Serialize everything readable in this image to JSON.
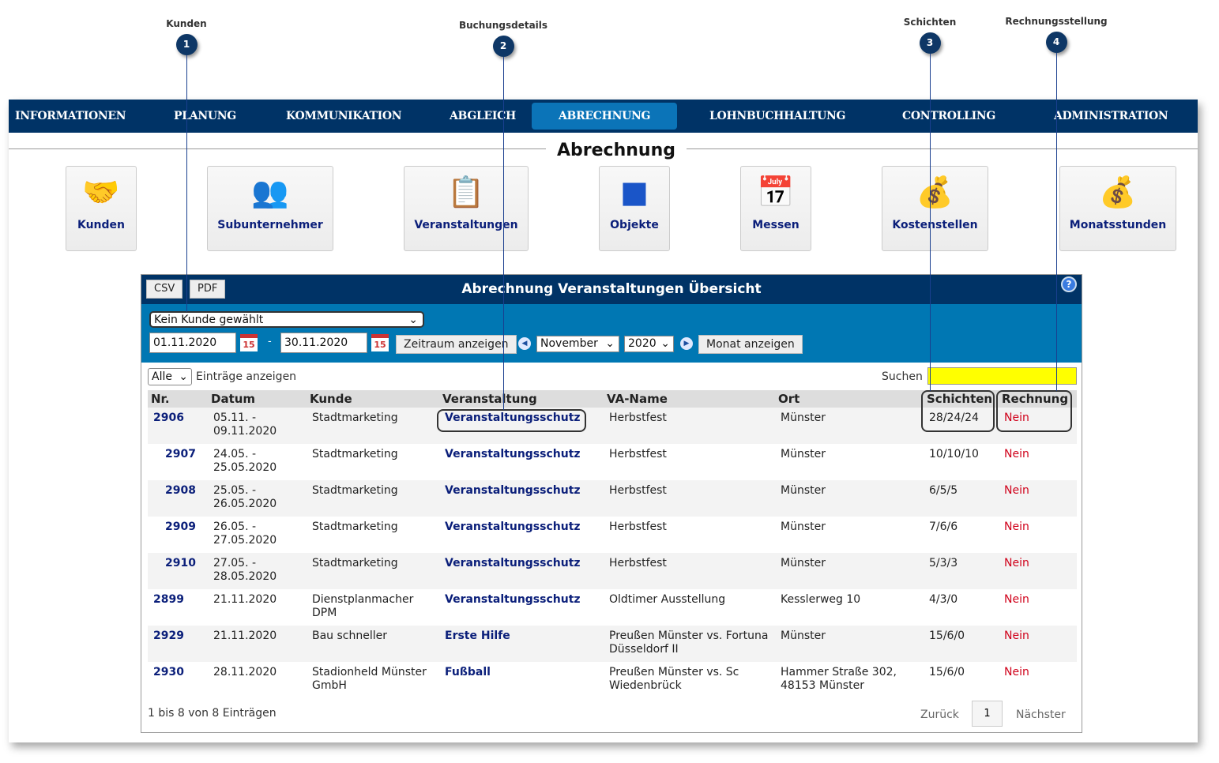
{
  "callouts": [
    {
      "n": "1",
      "label": "Kunden"
    },
    {
      "n": "2",
      "label": "Buchungsdetails"
    },
    {
      "n": "3",
      "label": "Schichten"
    },
    {
      "n": "4",
      "label": "Rechnungsstellung"
    }
  ],
  "nav": [
    "INFORMATIONEN",
    "PLANUNG",
    "KOMMUNIKATION",
    "ABGLEICH",
    "ABRECHNUNG",
    "LOHNBUCHHALTUNG",
    "CONTROLLING",
    "ADMINISTRATION"
  ],
  "section_title": "Abrechnung",
  "tiles": [
    "Kunden",
    "Subunternehmer",
    "Veranstaltungen",
    "Objekte",
    "Messen",
    "Kostenstellen",
    "Monatsstunden"
  ],
  "panel": {
    "title": "Abrechnung Veranstaltungen Übersicht",
    "csv": "CSV",
    "pdf": "PDF",
    "customer_select": "Kein Kunde gewählt",
    "date_from": "01.11.2020",
    "date_to": "30.11.2020",
    "dash": "-",
    "cal_day": "15",
    "range_btn": "Zeitraum anzeigen",
    "month": "November",
    "year": "2020",
    "month_btn": "Monat anzeigen",
    "entries_select": "Alle",
    "entries_label": "Einträge anzeigen",
    "search_label": "Suchen",
    "search_value": "",
    "search_color": "#ffff00"
  },
  "table": {
    "headers": [
      "Nr.",
      "Datum",
      "Kunde",
      "Veranstaltung",
      "VA-Name",
      "Ort",
      "Schichten",
      "Rechnung"
    ],
    "rows": [
      [
        "2906",
        "05.11. - 09.11.2020",
        "Stadtmarketing",
        "Veranstaltungsschutz",
        "Herbstfest",
        "Münster",
        "28/24/24",
        "Nein"
      ],
      [
        "2907",
        "24.05. - 25.05.2020",
        "Stadtmarketing",
        "Veranstaltungsschutz",
        "Herbstfest",
        "Münster",
        "10/10/10",
        "Nein"
      ],
      [
        "2908",
        "25.05. - 26.05.2020",
        "Stadtmarketing",
        "Veranstaltungsschutz",
        "Herbstfest",
        "Münster",
        "6/5/5",
        "Nein"
      ],
      [
        "2909",
        "26.05. - 27.05.2020",
        "Stadtmarketing",
        "Veranstaltungsschutz",
        "Herbstfest",
        "Münster",
        "7/6/6",
        "Nein"
      ],
      [
        "2910",
        "27.05. - 28.05.2020",
        "Stadtmarketing",
        "Veranstaltungsschutz",
        "Herbstfest",
        "Münster",
        "5/3/3",
        "Nein"
      ],
      [
        "2899",
        "21.11.2020",
        "Dienstplanmacher DPM",
        "Veranstaltungsschutz",
        "Oldtimer Ausstellung",
        "Kesslerweg 10",
        "4/3/0",
        "Nein"
      ],
      [
        "2929",
        "21.11.2020",
        "Bau schneller",
        "Erste Hilfe",
        "Preußen Münster vs. Fortuna Düsseldorf II",
        "Münster",
        "15/6/0",
        "Nein"
      ],
      [
        "2930",
        "28.11.2020",
        "Stadionheld Münster GmbH",
        "Fußball",
        "Preußen Münster vs. Sc Wiedenbrück",
        "Hammer Straße 302, 48153 Münster",
        "15/6/0",
        "Nein"
      ]
    ]
  },
  "footer": {
    "info": "1 bis 8 von 8 Einträgen",
    "prev": "Zurück",
    "page": "1",
    "next": "Nächster"
  }
}
